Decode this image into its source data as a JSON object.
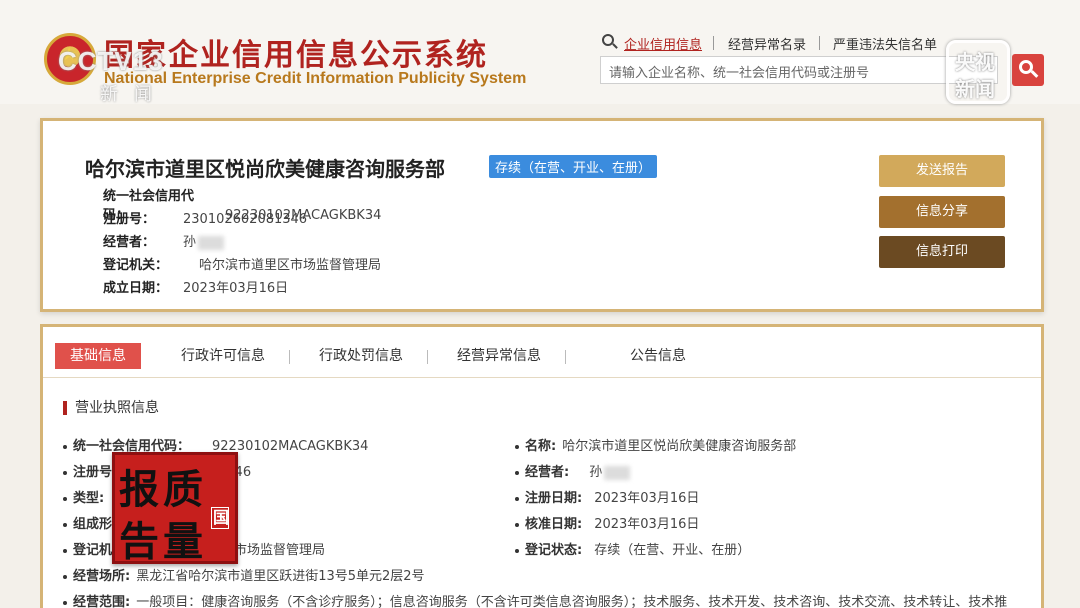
{
  "header": {
    "title": "国家企业信用信息公示系统",
    "subtitle": "National Enterprise Credit Information Publicity System",
    "watermark_logo": "CCTV13",
    "watermark_news": "新闻",
    "nav": [
      "企业信用信息",
      "经营异常名录",
      "严重违法失信名单"
    ],
    "search_placeholder": "请输入企业名称、统一社会信用代码或注册号",
    "corner_logo_top": "央视",
    "corner_logo_bottom": "新闻"
  },
  "company": {
    "name": "哈尔滨市道里区悦尚欣美健康咨询服务部",
    "status": "存续（在营、开业、在册）",
    "fields": [
      {
        "label": "统一社会信用代码：",
        "value": "92230102MACAGKBK34"
      },
      {
        "label": "注册号：",
        "value": "230102602081346"
      },
      {
        "label": "经营者：",
        "value": "孙"
      },
      {
        "label": "登记机关：",
        "value": "哈尔滨市道里区市场监督管理局"
      },
      {
        "label": "成立日期：",
        "value": "2023年03月16日"
      }
    ],
    "buttons": [
      "发送报告",
      "信息分享",
      "信息打印"
    ]
  },
  "tabs": [
    "基础信息",
    "行政许可信息",
    "行政处罚信息",
    "经营异常信息",
    "公告信息"
  ],
  "section": {
    "title": "营业执照信息",
    "left_fields": [
      {
        "label": "统一社会信用代码：",
        "value": "92230102MACAGKBK34"
      },
      {
        "label": "注册号",
        "value": "1346"
      },
      {
        "label": "类型:",
        "value": ""
      },
      {
        "label": "组成形",
        "value": ""
      },
      {
        "label": "登记机",
        "value": "市场监督管理局"
      },
      {
        "label": "经营场所:",
        "value": "黑龙江省哈尔滨市道里区跃进街13号5单元2层2号"
      },
      {
        "label": "经营范围:",
        "value": "一般项目：健康咨询服务（不含诊疗服务）；信息咨询服务（不含许可类信息咨询服务）；技术服务、技术开发、技术咨询、技术交流、技术转让、技术推"
      }
    ],
    "right_fields": [
      {
        "label": "名称:",
        "value": "哈尔滨市道里区悦尚欣美健康咨询服务部"
      },
      {
        "label": "经营者:",
        "value": "孙"
      },
      {
        "label": "注册日期:",
        "value": "2023年03月16日"
      },
      {
        "label": "核准日期:",
        "value": "2023年03月16日"
      },
      {
        "label": "登记状态:",
        "value": "存续（在营、开业、在册）"
      }
    ]
  },
  "stamp": {
    "chars": [
      "报",
      "质",
      "告",
      "量"
    ],
    "side": "国"
  }
}
